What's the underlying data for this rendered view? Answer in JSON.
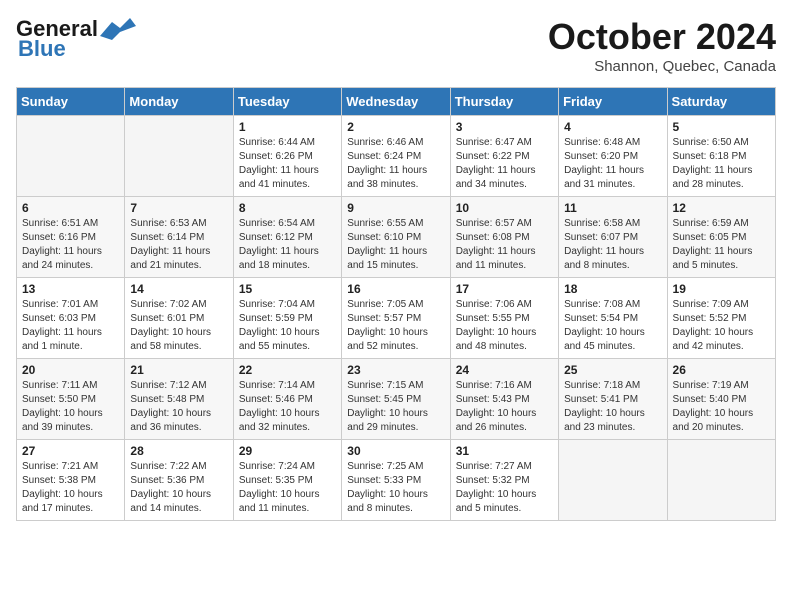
{
  "header": {
    "logo_line1": "General",
    "logo_line2": "Blue",
    "month": "October 2024",
    "location": "Shannon, Quebec, Canada"
  },
  "weekdays": [
    "Sunday",
    "Monday",
    "Tuesday",
    "Wednesday",
    "Thursday",
    "Friday",
    "Saturday"
  ],
  "weeks": [
    [
      {
        "day": "",
        "empty": true
      },
      {
        "day": "",
        "empty": true
      },
      {
        "day": "1",
        "sunrise": "6:44 AM",
        "sunset": "6:26 PM",
        "daylight": "11 hours and 41 minutes."
      },
      {
        "day": "2",
        "sunrise": "6:46 AM",
        "sunset": "6:24 PM",
        "daylight": "11 hours and 38 minutes."
      },
      {
        "day": "3",
        "sunrise": "6:47 AM",
        "sunset": "6:22 PM",
        "daylight": "11 hours and 34 minutes."
      },
      {
        "day": "4",
        "sunrise": "6:48 AM",
        "sunset": "6:20 PM",
        "daylight": "11 hours and 31 minutes."
      },
      {
        "day": "5",
        "sunrise": "6:50 AM",
        "sunset": "6:18 PM",
        "daylight": "11 hours and 28 minutes."
      }
    ],
    [
      {
        "day": "6",
        "sunrise": "6:51 AM",
        "sunset": "6:16 PM",
        "daylight": "11 hours and 24 minutes."
      },
      {
        "day": "7",
        "sunrise": "6:53 AM",
        "sunset": "6:14 PM",
        "daylight": "11 hours and 21 minutes."
      },
      {
        "day": "8",
        "sunrise": "6:54 AM",
        "sunset": "6:12 PM",
        "daylight": "11 hours and 18 minutes."
      },
      {
        "day": "9",
        "sunrise": "6:55 AM",
        "sunset": "6:10 PM",
        "daylight": "11 hours and 15 minutes."
      },
      {
        "day": "10",
        "sunrise": "6:57 AM",
        "sunset": "6:08 PM",
        "daylight": "11 hours and 11 minutes."
      },
      {
        "day": "11",
        "sunrise": "6:58 AM",
        "sunset": "6:07 PM",
        "daylight": "11 hours and 8 minutes."
      },
      {
        "day": "12",
        "sunrise": "6:59 AM",
        "sunset": "6:05 PM",
        "daylight": "11 hours and 5 minutes."
      }
    ],
    [
      {
        "day": "13",
        "sunrise": "7:01 AM",
        "sunset": "6:03 PM",
        "daylight": "11 hours and 1 minute."
      },
      {
        "day": "14",
        "sunrise": "7:02 AM",
        "sunset": "6:01 PM",
        "daylight": "10 hours and 58 minutes."
      },
      {
        "day": "15",
        "sunrise": "7:04 AM",
        "sunset": "5:59 PM",
        "daylight": "10 hours and 55 minutes."
      },
      {
        "day": "16",
        "sunrise": "7:05 AM",
        "sunset": "5:57 PM",
        "daylight": "10 hours and 52 minutes."
      },
      {
        "day": "17",
        "sunrise": "7:06 AM",
        "sunset": "5:55 PM",
        "daylight": "10 hours and 48 minutes."
      },
      {
        "day": "18",
        "sunrise": "7:08 AM",
        "sunset": "5:54 PM",
        "daylight": "10 hours and 45 minutes."
      },
      {
        "day": "19",
        "sunrise": "7:09 AM",
        "sunset": "5:52 PM",
        "daylight": "10 hours and 42 minutes."
      }
    ],
    [
      {
        "day": "20",
        "sunrise": "7:11 AM",
        "sunset": "5:50 PM",
        "daylight": "10 hours and 39 minutes."
      },
      {
        "day": "21",
        "sunrise": "7:12 AM",
        "sunset": "5:48 PM",
        "daylight": "10 hours and 36 minutes."
      },
      {
        "day": "22",
        "sunrise": "7:14 AM",
        "sunset": "5:46 PM",
        "daylight": "10 hours and 32 minutes."
      },
      {
        "day": "23",
        "sunrise": "7:15 AM",
        "sunset": "5:45 PM",
        "daylight": "10 hours and 29 minutes."
      },
      {
        "day": "24",
        "sunrise": "7:16 AM",
        "sunset": "5:43 PM",
        "daylight": "10 hours and 26 minutes."
      },
      {
        "day": "25",
        "sunrise": "7:18 AM",
        "sunset": "5:41 PM",
        "daylight": "10 hours and 23 minutes."
      },
      {
        "day": "26",
        "sunrise": "7:19 AM",
        "sunset": "5:40 PM",
        "daylight": "10 hours and 20 minutes."
      }
    ],
    [
      {
        "day": "27",
        "sunrise": "7:21 AM",
        "sunset": "5:38 PM",
        "daylight": "10 hours and 17 minutes."
      },
      {
        "day": "28",
        "sunrise": "7:22 AM",
        "sunset": "5:36 PM",
        "daylight": "10 hours and 14 minutes."
      },
      {
        "day": "29",
        "sunrise": "7:24 AM",
        "sunset": "5:35 PM",
        "daylight": "10 hours and 11 minutes."
      },
      {
        "day": "30",
        "sunrise": "7:25 AM",
        "sunset": "5:33 PM",
        "daylight": "10 hours and 8 minutes."
      },
      {
        "day": "31",
        "sunrise": "7:27 AM",
        "sunset": "5:32 PM",
        "daylight": "10 hours and 5 minutes."
      },
      {
        "day": "",
        "empty": true
      },
      {
        "day": "",
        "empty": true
      }
    ]
  ]
}
